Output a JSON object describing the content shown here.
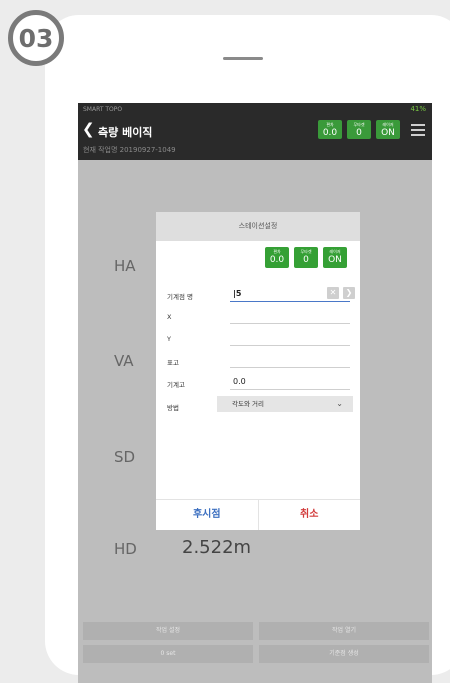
{
  "step": "03",
  "status": {
    "app": "SMART TOPO",
    "battery": "41%"
  },
  "appbar": {
    "title": "측량 베이직",
    "chips": [
      {
        "label": "편차",
        "value": "0.0"
      },
      {
        "label": "무타겟",
        "value": "0"
      },
      {
        "label": "레이저",
        "value": "ON"
      }
    ]
  },
  "project": {
    "text": "현재 작업명 20190927-1049"
  },
  "measurements": {
    "ha": "HA",
    "va": "VA",
    "sd": "SD",
    "hd": "HD",
    "hd_value": "2.522m"
  },
  "bottom": {
    "job_settings": "작업 설정",
    "job_open": "작업 열기",
    "set_count": "0 set",
    "base_point": "기준점 생성"
  },
  "dialog": {
    "title": "스테이션설정",
    "chips": [
      {
        "label": "편차",
        "value": "0.0"
      },
      {
        "label": "무타겟",
        "value": "0"
      },
      {
        "label": "레이저",
        "value": "ON"
      }
    ],
    "fields": {
      "point_name_label": "기계점 명",
      "point_name_value": "|5",
      "x_label": "X",
      "y_label": "Y",
      "elev_label": "표고",
      "inst_height_label": "기계고",
      "inst_height_value": "0.0",
      "method_label": "방법",
      "method_value": "각도와 거리"
    },
    "backsight": "후시점",
    "cancel": "취소"
  }
}
